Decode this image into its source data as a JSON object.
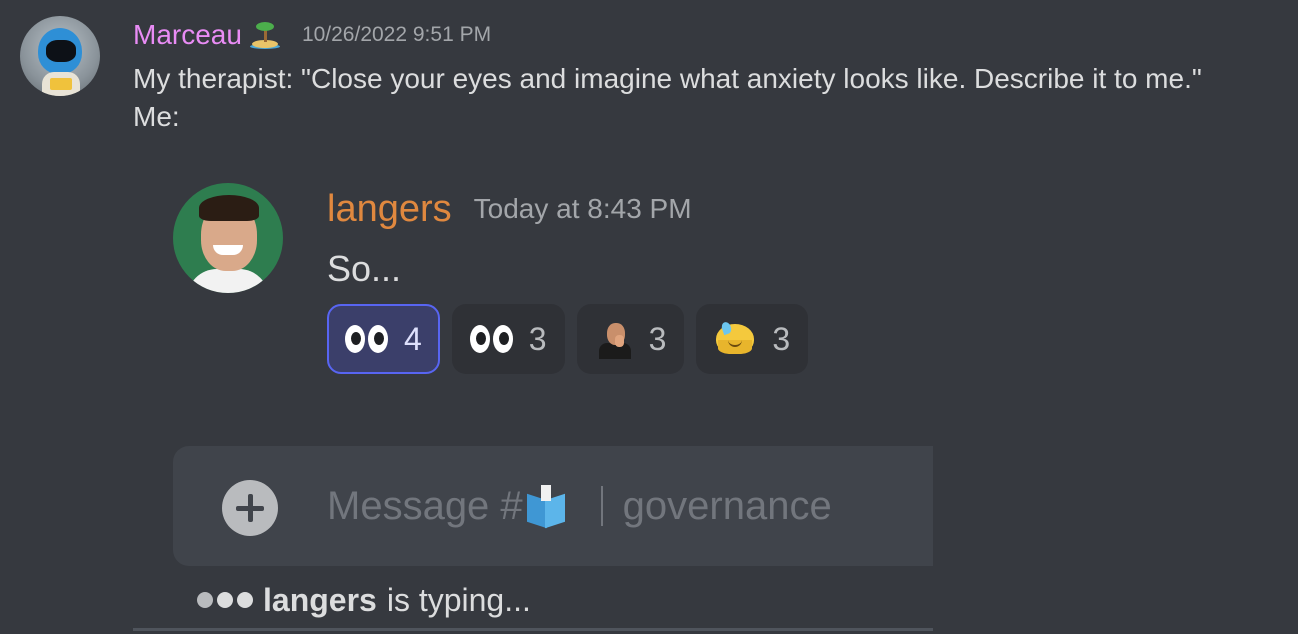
{
  "outer_message": {
    "username": "Marceau",
    "username_color": "#e98cf5",
    "status_icon": "desert-island-icon",
    "timestamp": "10/26/2022 9:51 PM",
    "text": "My therapist: \"Close your eyes and imagine what anxiety looks like. Describe it to me.\"\nMe:",
    "avatar_icon": "astronaut-figure-avatar"
  },
  "embedded_screenshot": {
    "username": "langers",
    "username_color": "#e0883f",
    "timestamp": "Today at 8:43 PM",
    "text": "So...",
    "avatar_icon": "smiling-man-avatar",
    "reactions": [
      {
        "emoji": "eyes-icon",
        "count": "4",
        "selected": true
      },
      {
        "emoji": "eyes-icon",
        "count": "3",
        "selected": false
      },
      {
        "emoji": "thinking-man-icon",
        "count": "3",
        "selected": false
      },
      {
        "emoji": "melting-face-icon",
        "count": "3",
        "selected": false
      }
    ],
    "composer": {
      "add_icon": "plus-circle-icon",
      "placeholder_prefix": "Message #",
      "channel_icon": "ballot-box-icon",
      "channel_name": "governance"
    },
    "typing": {
      "user": "langers",
      "text": "is typing..."
    }
  },
  "colors": {
    "background": "#36393f",
    "selected_reaction_border": "#5865f2"
  }
}
